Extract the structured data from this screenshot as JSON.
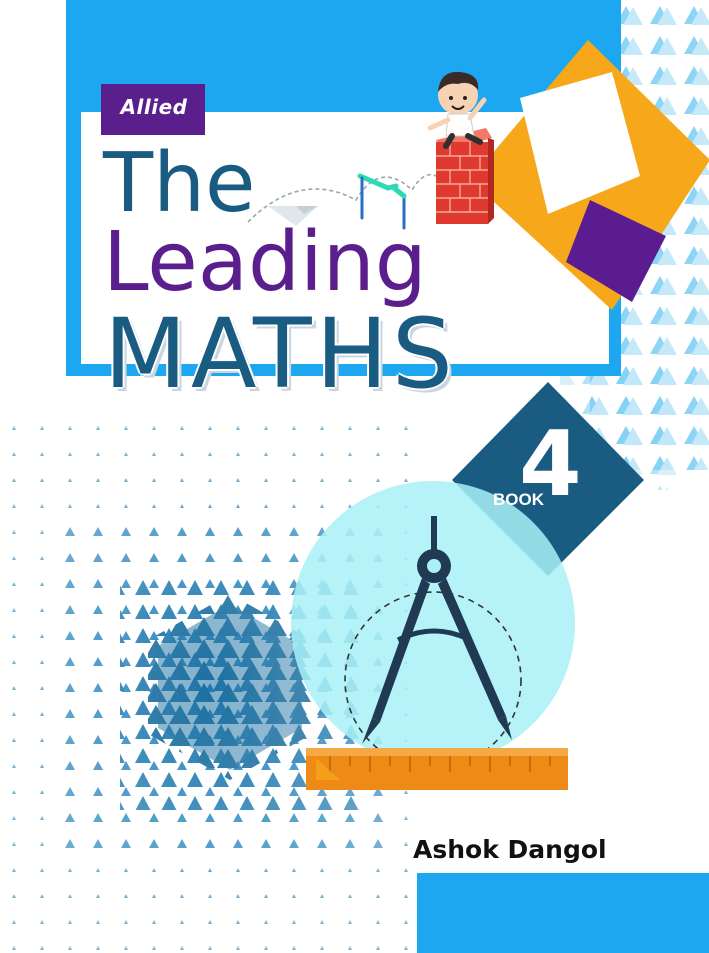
{
  "cover": {
    "publisher": "Allied",
    "title_line1": "The",
    "title_line2": "Leading",
    "title_line3": "MATHS",
    "book_label": "BOOK",
    "book_number": "4",
    "author": "Ashok Dangol"
  },
  "colors": {
    "sky_blue": "#1da7f0",
    "navy_blue": "#1a5b82",
    "purple": "#5a1f8c",
    "orange": "#f6a81a",
    "ruler_orange": "#ee8a16",
    "cyan_circle": "#a9f1f7"
  },
  "icons": [
    "compass-icon",
    "ruler-icon",
    "boy-character-icon",
    "brick-wall-icon",
    "hurdle-icon"
  ]
}
